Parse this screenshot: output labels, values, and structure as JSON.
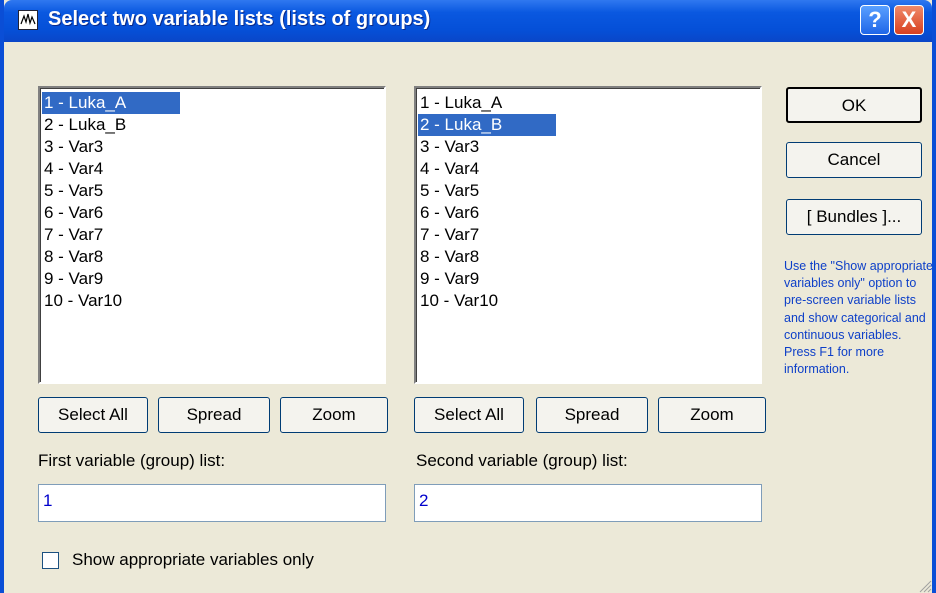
{
  "window": {
    "title": "Select two variable lists (lists of groups)",
    "help_label": "?",
    "close_label": "X"
  },
  "list1": {
    "items": [
      "1 - Luka_A",
      "2 - Luka_B",
      "3 - Var3",
      "4 - Var4",
      "5 - Var5",
      "6 - Var6",
      "7 - Var7",
      "8 - Var8",
      "9 - Var9",
      "10 - Var10"
    ],
    "selected_index": 0,
    "select_all_label": "Select All",
    "spread_label": "Spread",
    "zoom_label": "Zoom",
    "field_label": "First variable (group) list:",
    "field_value": "1"
  },
  "list2": {
    "items": [
      "1 - Luka_A",
      "2 - Luka_B",
      "3 - Var3",
      "4 - Var4",
      "5 - Var5",
      "6 - Var6",
      "7 - Var7",
      "8 - Var8",
      "9 - Var9",
      "10 - Var10"
    ],
    "selected_index": 1,
    "select_all_label": "Select All",
    "spread_label": "Spread",
    "zoom_label": "Zoom",
    "field_label": "Second variable (group) list:",
    "field_value": "2"
  },
  "side": {
    "ok_label": "OK",
    "cancel_label": "Cancel",
    "bundles_label": "[ Bundles ]...",
    "info_text": "Use the \"Show appropriate variables only\" option to pre-screen variable lists and show categorical and continuous variables. Press F1 for more information."
  },
  "footer": {
    "checkbox_label": "Show appropriate variables only",
    "checked": false
  },
  "colors": {
    "titlebar": "#0a58e0",
    "selection": "#316ac5",
    "info_text": "#0d3fc8",
    "field_text": "#0000cc"
  }
}
